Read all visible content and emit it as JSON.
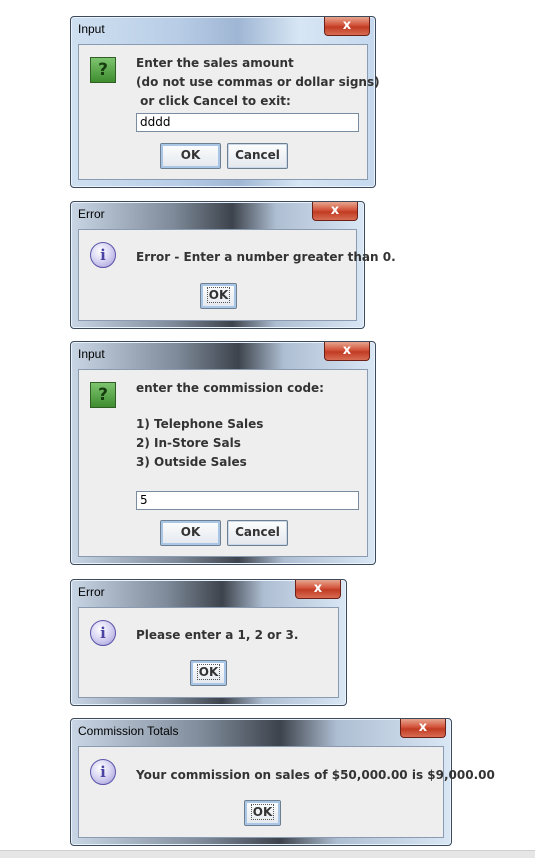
{
  "dialogs": {
    "input_sales": {
      "title": "Input",
      "close": "x",
      "icon": "?",
      "lines": [
        "Enter the sales amount",
        "(do not use commas or dollar signs)",
        " or click Cancel to exit:"
      ],
      "value": "dddd",
      "ok": "OK",
      "cancel": "Cancel"
    },
    "error_number": {
      "title": "Error",
      "close": "x",
      "icon": "i",
      "message": "Error - Enter a number greater than 0.",
      "ok": "OK"
    },
    "input_code": {
      "title": "Input",
      "close": "x",
      "icon": "?",
      "prompt": "enter the commission code:",
      "options": [
        "1) Telephone Sales",
        "2) In-Store Sals",
        "3) Outside Sales"
      ],
      "value": "5",
      "ok": "OK",
      "cancel": "Cancel"
    },
    "error_code": {
      "title": "Error",
      "close": "x",
      "icon": "i",
      "message": "Please enter a 1, 2 or 3.",
      "ok": "OK"
    },
    "totals": {
      "title": "Commission Totals",
      "close": "x",
      "icon": "i",
      "message": "Your commission on sales of $50,000.00 is $9,000.00",
      "ok": "OK"
    }
  }
}
